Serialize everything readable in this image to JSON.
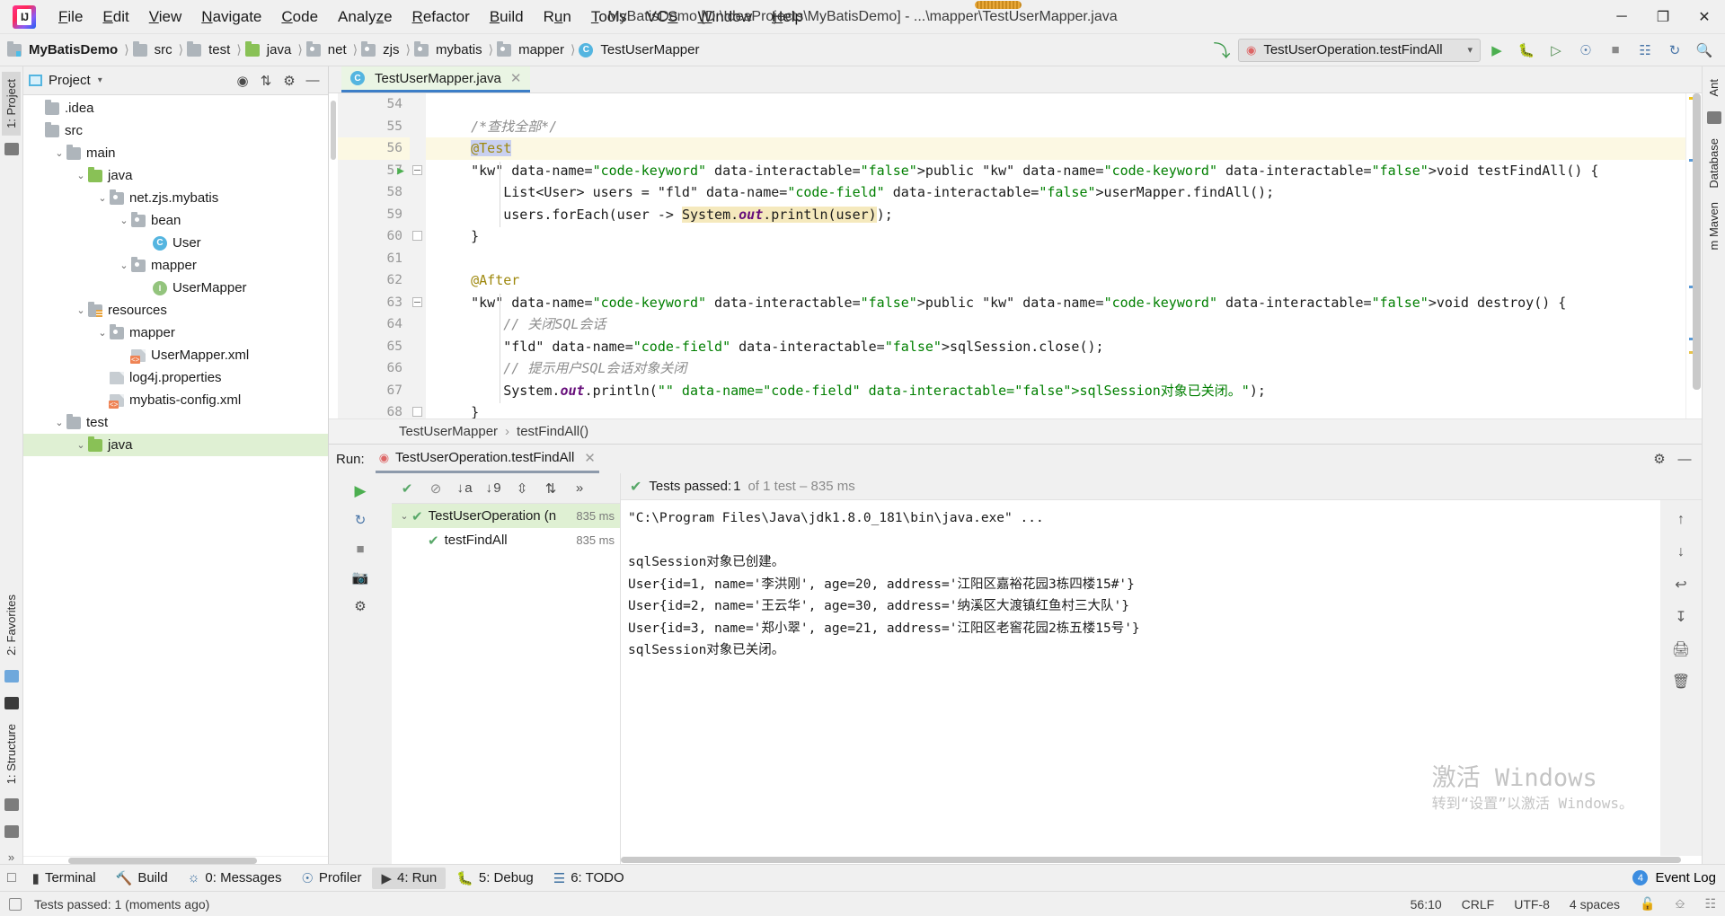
{
  "titlebar": {
    "app_logo": "intellij-idea-logo",
    "window_title": "MyBatisDemo [D:\\IdeaProjects\\MyBatisDemo] - ...\\mapper\\TestUserMapper.java",
    "menus": [
      "File",
      "Edit",
      "View",
      "Navigate",
      "Code",
      "Analyze",
      "Refactor",
      "Build",
      "Run",
      "Tools",
      "VCS",
      "Window",
      "Help"
    ],
    "window_buttons": {
      "minimize": "─",
      "maximize": "❐",
      "close": "✕"
    }
  },
  "navbar": {
    "breadcrumbs": [
      {
        "label": "MyBatisDemo",
        "icon": "module-icon"
      },
      {
        "label": "src",
        "icon": "folder-icon"
      },
      {
        "label": "test",
        "icon": "folder-icon"
      },
      {
        "label": "java",
        "icon": "source-folder-icon"
      },
      {
        "label": "net",
        "icon": "package-icon"
      },
      {
        "label": "zjs",
        "icon": "package-icon"
      },
      {
        "label": "mybatis",
        "icon": "package-icon"
      },
      {
        "label": "mapper",
        "icon": "package-icon"
      },
      {
        "label": "TestUserMapper",
        "icon": "class-icon"
      }
    ],
    "run_configuration": "TestUserOperation.testFindAll",
    "buttons": [
      "run-button",
      "debug-button",
      "run-coverage-button",
      "profiler-button",
      "stop-button",
      "build-button",
      "update-button",
      "search-button"
    ]
  },
  "left_tool_window_bar": {
    "tabs": [
      "1: Project"
    ]
  },
  "right_tool_window_bar": {
    "tabs": [
      "Ant",
      "Database",
      "m Maven"
    ]
  },
  "project_panel": {
    "title": "Project",
    "actions": [
      "locate-icon",
      "collapse-all-icon",
      "settings-icon",
      "hide-icon"
    ],
    "tree": [
      {
        "label": ".idea",
        "depth": 1,
        "icon": "folder-icon",
        "twisty": "",
        "selected": false
      },
      {
        "label": "src",
        "depth": 1,
        "icon": "folder-icon",
        "twisty": "",
        "selected": false
      },
      {
        "label": "main",
        "depth": 2,
        "icon": "folder-icon",
        "twisty": "⌄",
        "selected": false
      },
      {
        "label": "java",
        "depth": 3,
        "icon": "source-folder-icon",
        "twisty": "⌄",
        "selected": false
      },
      {
        "label": "net.zjs.mybatis",
        "depth": 4,
        "icon": "package-icon",
        "twisty": "⌄",
        "selected": false
      },
      {
        "label": "bean",
        "depth": 5,
        "icon": "package-icon",
        "twisty": "⌄",
        "selected": false
      },
      {
        "label": "User",
        "depth": 6,
        "icon": "class-icon",
        "twisty": "",
        "selected": false
      },
      {
        "label": "mapper",
        "depth": 5,
        "icon": "package-icon",
        "twisty": "⌄",
        "selected": false
      },
      {
        "label": "UserMapper",
        "depth": 6,
        "icon": "interface-icon",
        "twisty": "",
        "selected": false
      },
      {
        "label": "resources",
        "depth": 3,
        "icon": "resources-folder-icon",
        "twisty": "⌄",
        "selected": false
      },
      {
        "label": "mapper",
        "depth": 4,
        "icon": "package-icon",
        "twisty": "⌄",
        "selected": false
      },
      {
        "label": "UserMapper.xml",
        "depth": 5,
        "icon": "xml-file-icon",
        "twisty": "",
        "selected": false
      },
      {
        "label": "log4j.properties",
        "depth": 4,
        "icon": "properties-file-icon",
        "twisty": "",
        "selected": false
      },
      {
        "label": "mybatis-config.xml",
        "depth": 4,
        "icon": "xml-file-icon",
        "twisty": "",
        "selected": false
      },
      {
        "label": "test",
        "depth": 2,
        "icon": "folder-icon",
        "twisty": "⌄",
        "selected": false
      },
      {
        "label": "java",
        "depth": 3,
        "icon": "test-source-folder-icon",
        "twisty": "⌄",
        "selected": true
      }
    ]
  },
  "editor": {
    "tab": {
      "label": "TestUserMapper.java",
      "icon": "java-class-icon",
      "close": "✕"
    },
    "lines": [
      {
        "num": "54",
        "text": "",
        "highlight": false,
        "fold": "",
        "runner": false
      },
      {
        "num": "55",
        "text": "    /*查找全部*/",
        "highlight": false,
        "fold": "",
        "runner": false
      },
      {
        "num": "56",
        "text": "    @Test",
        "highlight": true,
        "fold": "",
        "runner": false
      },
      {
        "num": "57",
        "text": "    public void testFindAll() {",
        "highlight": false,
        "fold": "open",
        "runner": true
      },
      {
        "num": "58",
        "text": "        List<User> users = userMapper.findAll();",
        "highlight": false,
        "fold": "",
        "runner": false
      },
      {
        "num": "59",
        "text": "        users.forEach(user -> System.out.println(user));",
        "highlight": false,
        "fold": "",
        "runner": false
      },
      {
        "num": "60",
        "text": "    }",
        "highlight": false,
        "fold": "close",
        "runner": false
      },
      {
        "num": "61",
        "text": "",
        "highlight": false,
        "fold": "",
        "runner": false
      },
      {
        "num": "62",
        "text": "    @After",
        "highlight": false,
        "fold": "",
        "runner": false
      },
      {
        "num": "63",
        "text": "    public void destroy() {",
        "highlight": false,
        "fold": "open",
        "runner": false
      },
      {
        "num": "64",
        "text": "        // 关闭SQL会话",
        "highlight": false,
        "fold": "",
        "runner": false
      },
      {
        "num": "65",
        "text": "        sqlSession.close();",
        "highlight": false,
        "fold": "",
        "runner": false
      },
      {
        "num": "66",
        "text": "        // 提示用户SQL会话对象关闭",
        "highlight": false,
        "fold": "",
        "runner": false
      },
      {
        "num": "67",
        "text": "        System.out.println(\"sqlSession对象已关闭。\");",
        "highlight": false,
        "fold": "",
        "runner": false
      },
      {
        "num": "68",
        "text": "    }",
        "highlight": false,
        "fold": "close",
        "runner": false
      }
    ],
    "breadcrumb": {
      "class": "TestUserMapper",
      "separator": "›",
      "method": "testFindAll()"
    }
  },
  "run_panel": {
    "label": "Run:",
    "tab_title": "TestUserOperation.testFindAll",
    "tab_close": "✕",
    "status": {
      "prefix": "Tests passed: ",
      "count": "1",
      "suffix": " of 1 test – 835 ms",
      "check": "✔"
    },
    "tests": [
      {
        "label": "TestUserOperation (n",
        "time": "835 ms",
        "depth": 1,
        "selected": true,
        "check": "✔"
      },
      {
        "label": "testFindAll",
        "time": "835 ms",
        "depth": 2,
        "selected": false,
        "check": "✔"
      }
    ],
    "console": [
      {
        "text": "\"C:\\Program Files\\Java\\jdk1.8.0_181\\bin\\java.exe\" ...",
        "kind": "command"
      },
      {
        "text": "",
        "kind": "plain"
      },
      {
        "text": "sqlSession对象已创建。",
        "kind": "plain"
      },
      {
        "text": "User{id=1, name='李洪刚', age=20, address='江阳区嘉裕花园3栋四楼15#'}",
        "kind": "plain"
      },
      {
        "text": "User{id=2, name='王云华', age=30, address='纳溪区大渡镇红鱼村三大队'}",
        "kind": "plain"
      },
      {
        "text": "User{id=3, name='郑小翠', age=21, address='江阳区老窖花园2栋五楼15号'}",
        "kind": "plain"
      },
      {
        "text": "sqlSession对象已关闭。",
        "kind": "plain"
      }
    ],
    "watermark": {
      "line1": "激活 Windows",
      "line2": "转到“设置”以激活 Windows。"
    }
  },
  "bottom_tabs": [
    {
      "label": "Terminal",
      "icon": "terminal-icon",
      "selected": false,
      "mnemonic": ""
    },
    {
      "label": "Build",
      "icon": "build-icon",
      "selected": false,
      "mnemonic": ""
    },
    {
      "label": "0: Messages",
      "icon": "messages-icon",
      "selected": false,
      "mnemonic": "0"
    },
    {
      "label": "Profiler",
      "icon": "profiler-icon",
      "selected": false,
      "mnemonic": ""
    },
    {
      "label": "4: Run",
      "icon": "run-icon",
      "selected": true,
      "mnemonic": "4"
    },
    {
      "label": "5: Debug",
      "icon": "debug-icon",
      "selected": false,
      "mnemonic": "5"
    },
    {
      "label": "6: TODO",
      "icon": "todo-icon",
      "selected": false,
      "mnemonic": "6"
    }
  ],
  "event_log": {
    "label": "Event Log",
    "badge": "4"
  },
  "statusbar": {
    "message": "Tests passed: 1 (moments ago)",
    "caret": "56:10",
    "line_separator": "CRLF",
    "encoding": "UTF-8",
    "indent": "4 spaces"
  },
  "colors": {
    "accent_blue": "#3d7ec7",
    "pass_green": "#59a869",
    "selection_green": "#dff0d3",
    "highlight_yellow": "#fcf8e3",
    "keyword_blue": "#00008f",
    "annotation_olive": "#9e880d",
    "field_purple": "#660e7a",
    "string_green": "#007f00",
    "comment_gray": "#8c8c8c"
  }
}
